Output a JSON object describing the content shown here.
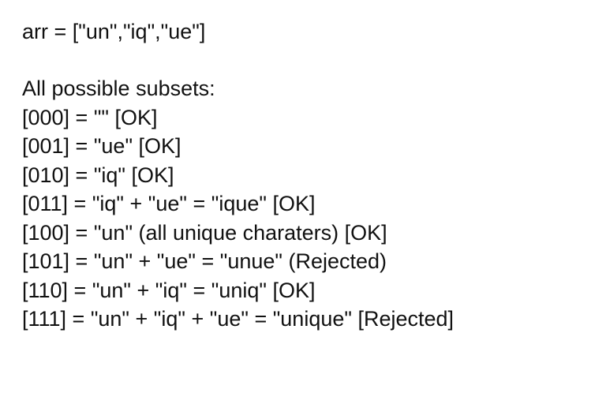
{
  "header": {
    "arr_line": "arr = [\"un\",\"iq\",\"ue\"]",
    "title": "All possible subsets:"
  },
  "subsets": [
    {
      "line": "[000] = \"\" [OK]"
    },
    {
      "line": "[001] = \"ue\" [OK]"
    },
    {
      "line": "[010] = \"iq\" [OK]"
    },
    {
      "line": "[011] = \"iq\" + \"ue\" = \"ique\" [OK]"
    },
    {
      "line": "[100] = \"un\" (all unique charaters) [OK]"
    },
    {
      "line": "[101] = \"un\" + \"ue\" = \"unue\" (Rejected)"
    },
    {
      "line": "[110] = \"un\" + \"iq\" = \"uniq\" [OK]"
    },
    {
      "line": "[111] = \"un\" + \"iq\" + \"ue\" = \"unique\" [Rejected]"
    }
  ]
}
